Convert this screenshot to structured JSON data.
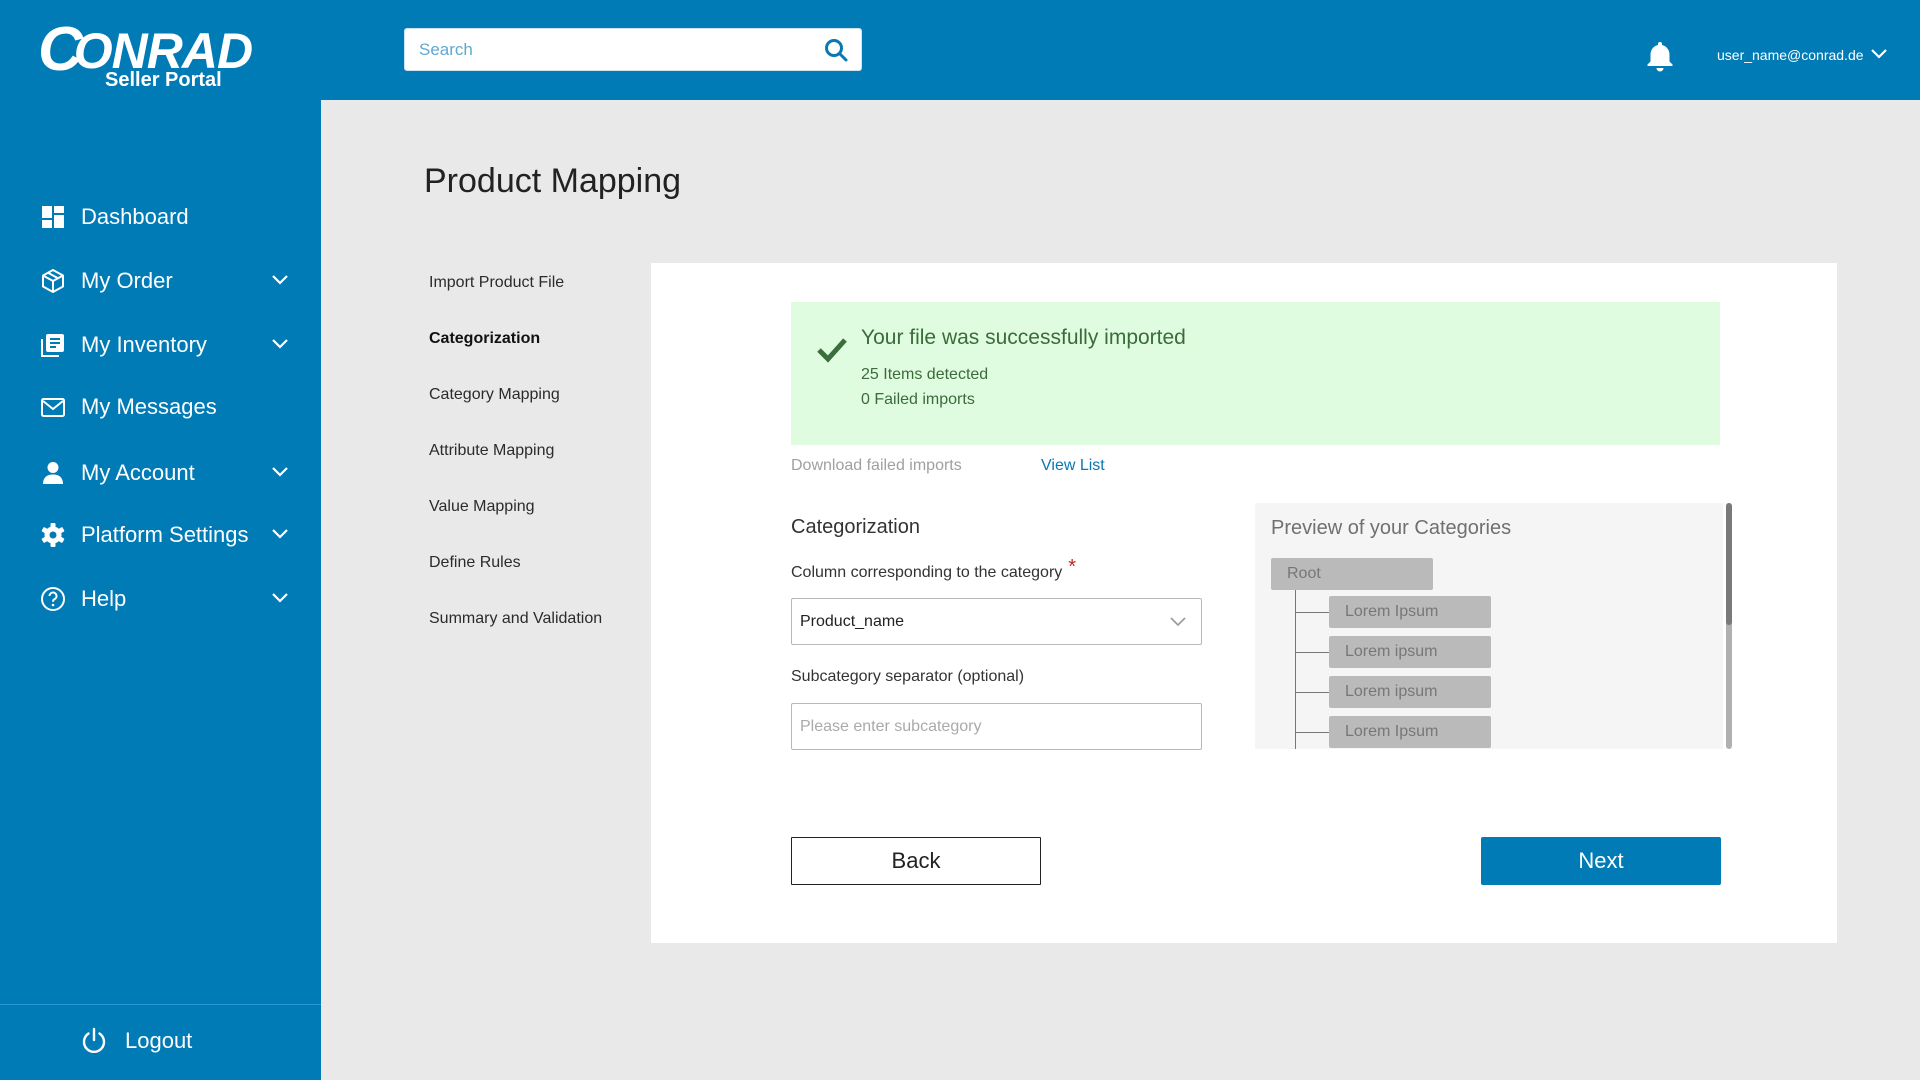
{
  "header": {
    "logo_text": "CONRAD",
    "logo_letter": "C",
    "logo_rest": "ONRAD",
    "logo_subtitle": "Seller Portal",
    "search_placeholder": "Search",
    "search_icon": "search-icon",
    "notification_icon": "bell-icon",
    "user_email": "user_name@conrad.de",
    "brand_color": "#007bb6"
  },
  "sidebar": {
    "items": [
      {
        "label": "Dashboard",
        "icon": "dashboard-icon",
        "expandable": false
      },
      {
        "label": "My Order",
        "icon": "box-icon",
        "expandable": true
      },
      {
        "label": "My Inventory",
        "icon": "inventory-icon",
        "expandable": true
      },
      {
        "label": "My Messages",
        "icon": "envelope-icon",
        "expandable": false
      },
      {
        "label": "My Account",
        "icon": "user-icon",
        "expandable": true
      },
      {
        "label": "Platform Settings",
        "icon": "gear-icon",
        "expandable": true
      },
      {
        "label": "Help",
        "icon": "help-icon",
        "expandable": true
      }
    ],
    "logout_label": "Logout"
  },
  "main": {
    "title": "Product Mapping",
    "steps": [
      {
        "label": "Import Product File",
        "active": false
      },
      {
        "label": "Categorization",
        "active": true
      },
      {
        "label": "Category Mapping",
        "active": false
      },
      {
        "label": "Attribute Mapping",
        "active": false
      },
      {
        "label": "Value Mapping",
        "active": false
      },
      {
        "label": "Define Rules",
        "active": false
      },
      {
        "label": "Summary and Validation",
        "active": false
      }
    ],
    "banner": {
      "title": "Your file was successfully imported",
      "items_detected": "25 Items detected",
      "failed_imports": "0 Failed imports",
      "color": "#e0fce0"
    },
    "download_failed_label": "Download failed imports",
    "view_list_label": "View List",
    "categorization": {
      "title": "Categorization",
      "column_label": "Column corresponding to the category",
      "required_marker": "*",
      "column_value": "Product_name",
      "separator_label": "Subcategory separator (optional)",
      "separator_placeholder": "Please enter subcategory",
      "separator_value": ""
    },
    "preview": {
      "title": "Preview of your Categories",
      "root": "Root",
      "children": [
        "Lorem Ipsum",
        "Lorem ipsum",
        "Lorem ipsum",
        "Lorem Ipsum"
      ],
      "scroll_position": 0.0
    },
    "back_label": "Back",
    "next_label": "Next"
  }
}
